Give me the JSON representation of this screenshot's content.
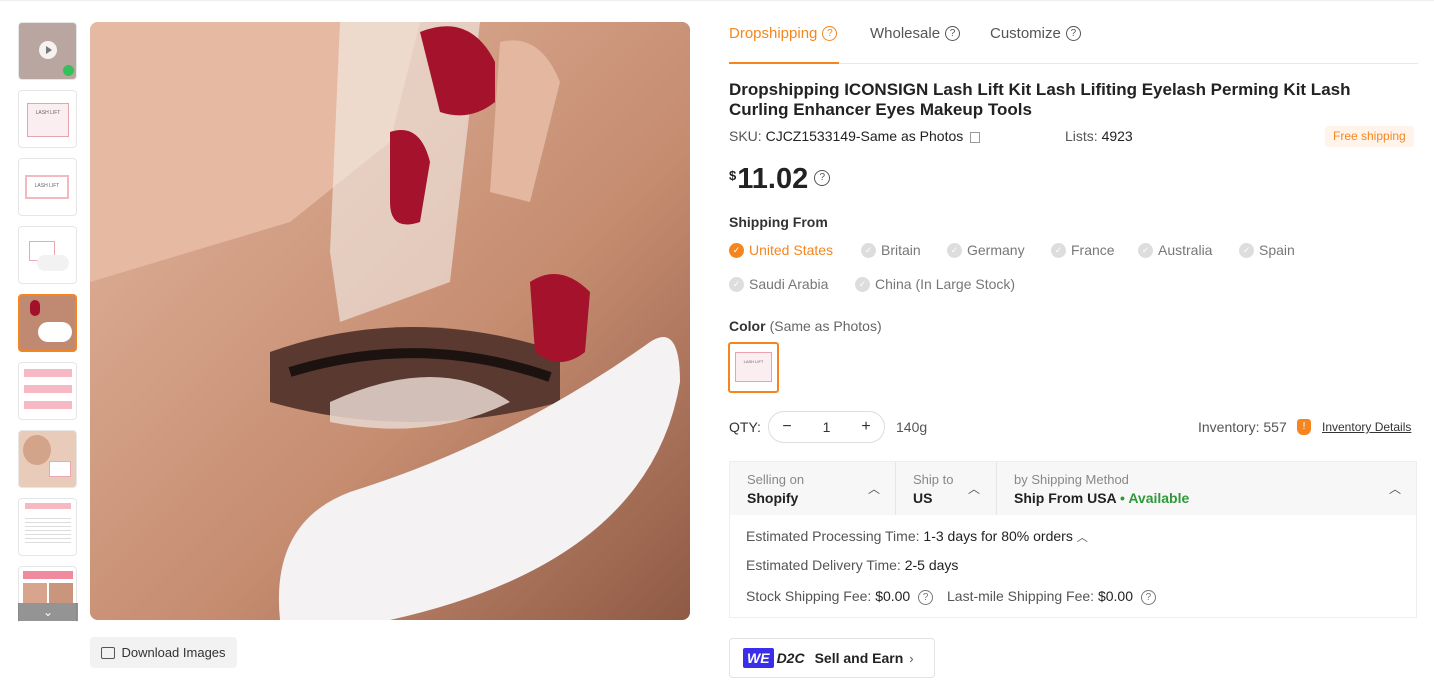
{
  "gallery": {
    "download_label": "Download Images",
    "thumb_lash_text": "LASH LIFT"
  },
  "tabs": [
    {
      "label": "Dropshipping"
    },
    {
      "label": "Wholesale"
    },
    {
      "label": "Customize"
    }
  ],
  "product": {
    "title": "Dropshipping ICONSIGN Lash Lift Kit Lash Lifiting Eyelash Perming Kit Lash Curling Enhancer Eyes Makeup Tools",
    "sku_label": "SKU:",
    "sku": "CJCZ1533149-Same as Photos",
    "lists_label": "Lists:",
    "lists": "4923",
    "free_shipping": "Free shipping",
    "currency": "$",
    "price": "11.02"
  },
  "shipping_from": {
    "label": "Shipping From",
    "options": [
      "United States",
      "Britain",
      "Germany",
      "France",
      "Australia",
      "Spain",
      "Saudi Arabia",
      "China (In Large Stock)"
    ],
    "selected": "United States"
  },
  "color": {
    "label": "Color",
    "selected": "(Same as Photos)"
  },
  "qty": {
    "label": "QTY:",
    "value": "1",
    "weight": "140g",
    "inventory_label": "Inventory:",
    "inventory": "557",
    "inventory_link": "Inventory Details"
  },
  "shipping": {
    "selling_on_label": "Selling on",
    "selling_on": "Shopify",
    "ship_to_label": "Ship to",
    "ship_to": "US",
    "method_label": "by Shipping Method",
    "method": "Ship From USA",
    "availability": "Available",
    "processing_label": "Estimated Processing Time:",
    "processing": "1-3 days for 80% orders",
    "delivery_label": "Estimated Delivery Time:",
    "delivery": "2-5 days",
    "stock_fee_label": "Stock Shipping Fee:",
    "stock_fee": "$0.00",
    "lastmile_fee_label": "Last-mile Shipping Fee:",
    "lastmile_fee": "$0.00"
  },
  "d2c": {
    "we": "WE",
    "d2c": "D2C",
    "label": "Sell and Earn"
  },
  "colors": {
    "accent": "#f5861f",
    "available": "#2f9a3a",
    "we_badge": "#3b2eea"
  }
}
